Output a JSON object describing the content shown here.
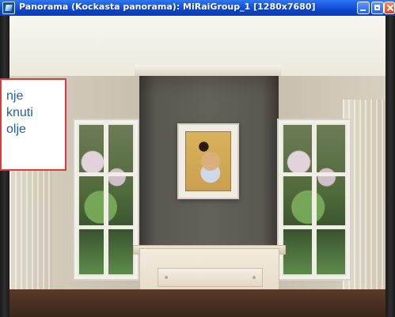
{
  "window": {
    "title": "Panorama (Kockasta panorama): MiRaiGroup_1 [1280x7680]",
    "controls": {
      "minimize": "minimize-icon",
      "maximize": "maximize-icon",
      "close": "close-icon"
    }
  },
  "callout": {
    "lines": [
      "nje",
      "knuti",
      "olje"
    ]
  },
  "colors": {
    "titlebar": "#0a43c9",
    "callout_border": "#e03a3a",
    "callout_text": "#1f5fae"
  }
}
